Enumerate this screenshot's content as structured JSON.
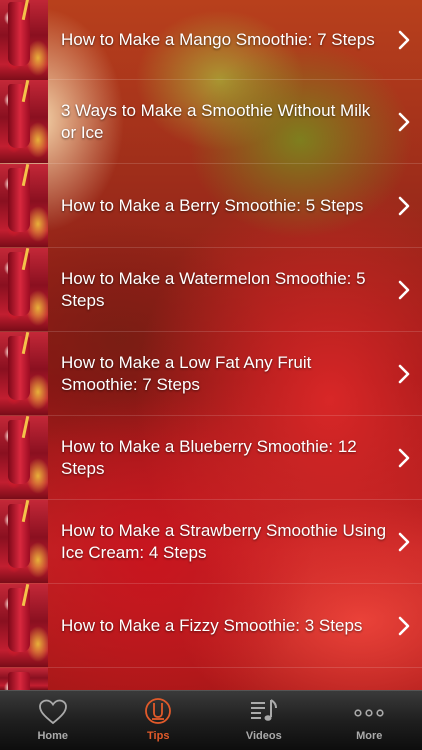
{
  "list": {
    "items": [
      {
        "label": "How to Make a Mango Smoothie: 7 Steps"
      },
      {
        "label": "3 Ways to Make a Smoothie Without Milk or Ice"
      },
      {
        "label": "How to Make a Berry Smoothie: 5 Steps"
      },
      {
        "label": "How to Make a Watermelon Smoothie: 5 Steps"
      },
      {
        "label": "How to Make a Low Fat Any Fruit Smoothie: 7 Steps"
      },
      {
        "label": "How to Make a Blueberry Smoothie: 12 Steps"
      },
      {
        "label": "How to Make a Strawberry Smoothie Using Ice Cream: 4 Steps"
      },
      {
        "label": "How to Make a Fizzy Smoothie: 3 Steps"
      }
    ]
  },
  "tabbar": {
    "home": {
      "label": "Home",
      "icon": "heart-icon"
    },
    "tips": {
      "label": "Tips",
      "icon": "tips-icon"
    },
    "videos": {
      "label": "Videos",
      "icon": "music-note-list-icon"
    },
    "more": {
      "label": "More",
      "icon": "ellipsis-icon"
    },
    "active": "tips",
    "active_color": "#e25a2a",
    "inactive_color": "#aaaaaa"
  }
}
